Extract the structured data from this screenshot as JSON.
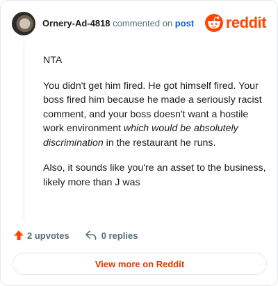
{
  "comment": {
    "username": "Ornery-Ad-4818",
    "action_text": "commented on",
    "post_link": "post",
    "paragraphs": {
      "p1": "NTA",
      "p2_part1": "You didn't get him fired. He got himself fired. Your boss fired him because he made a seriously racist comment, and your boss doesn't want a hostile work environment ",
      "p2_italic": "which would be absolutely discrimination",
      "p2_part2": " in the restaurant he runs.",
      "p3": "Also, it sounds like you're an asset to the business, likely more than J was"
    }
  },
  "brand": {
    "wordmark": "reddit",
    "accent_color": "#ff4500",
    "logo_icon": "reddit-snoo-icon"
  },
  "actions": {
    "upvotes": "2 upvotes",
    "replies": "0 replies",
    "upvote_icon": "upvote-arrow-icon",
    "reply_icon": "reply-arrow-icon"
  },
  "footer": {
    "view_more_label": "View more on Reddit"
  }
}
